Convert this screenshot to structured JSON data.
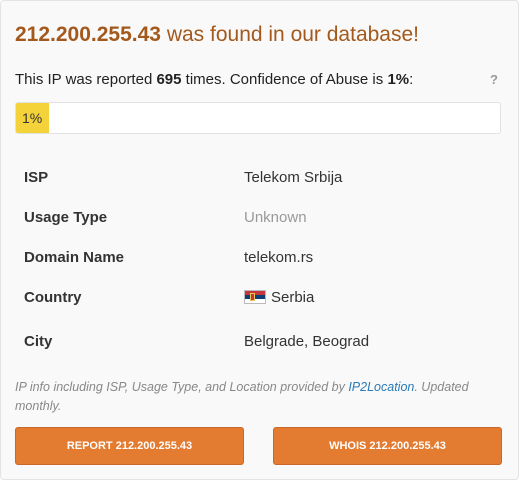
{
  "header": {
    "ip": "212.200.255.43",
    "found_text": " was found in our database!"
  },
  "report": {
    "prefix": "This IP was reported ",
    "count": "695",
    "middle": " times. Confidence of Abuse is ",
    "confidence": "1%",
    "suffix": ":",
    "help_label": "?"
  },
  "confidence_bar": {
    "label": "1%",
    "percent": 1,
    "color": "#f4d23a"
  },
  "details": [
    {
      "label": "ISP",
      "value": "Telekom Srbija"
    },
    {
      "label": "Usage Type",
      "value": "Unknown"
    },
    {
      "label": "Domain Name",
      "value": "telekom.rs"
    },
    {
      "label": "Country",
      "value": "Serbia",
      "flag": "serbia-flag-icon"
    },
    {
      "label": "City",
      "value": "Belgrade, Beograd"
    }
  ],
  "footnote": {
    "prefix": "IP info including ISP, Usage Type, and Location provided by ",
    "link": "IP2Location",
    "suffix": ". Updated monthly."
  },
  "buttons": {
    "report": "REPORT 212.200.255.43",
    "whois": "WHOIS 212.200.255.43"
  },
  "colors": {
    "title": "#a3591c",
    "button": "#e37b30",
    "link": "#2a7ab8"
  }
}
